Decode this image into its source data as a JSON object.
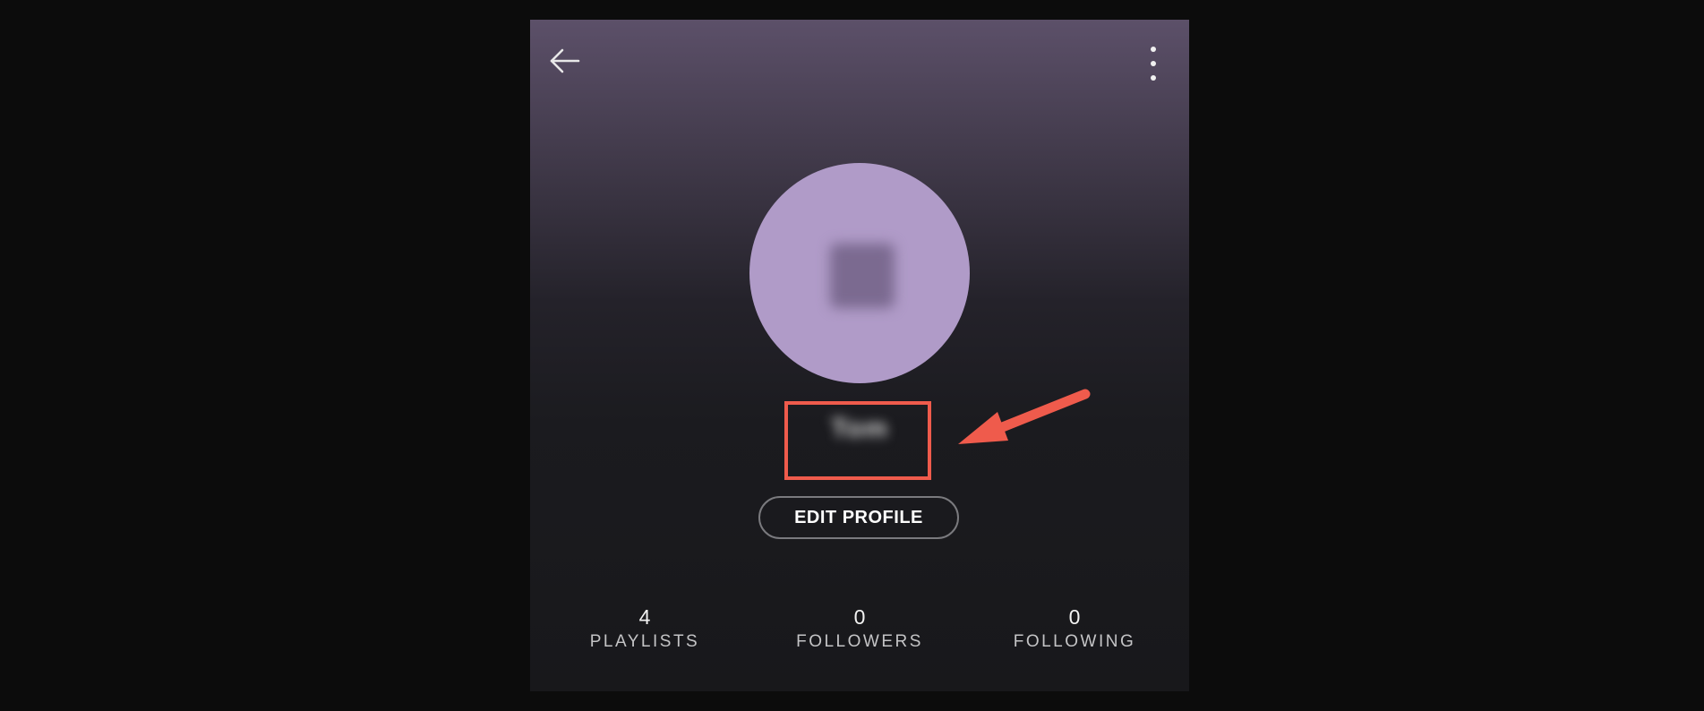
{
  "profile": {
    "display_name": "Tom",
    "avatar_initial": "T",
    "edit_button_label": "EDIT PROFILE"
  },
  "stats": [
    {
      "count": "4",
      "label": "PLAYLISTS"
    },
    {
      "count": "0",
      "label": "FOLLOWERS"
    },
    {
      "count": "0",
      "label": "FOLLOWING"
    }
  ],
  "icons": {
    "back": "arrow-left-icon",
    "menu": "more-vertical-icon"
  },
  "colors": {
    "avatar_bg": "#b09bc8",
    "annotation": "#ef5b4c",
    "header_gradient_top": "#5c5069",
    "page_bg": "#18181b"
  }
}
